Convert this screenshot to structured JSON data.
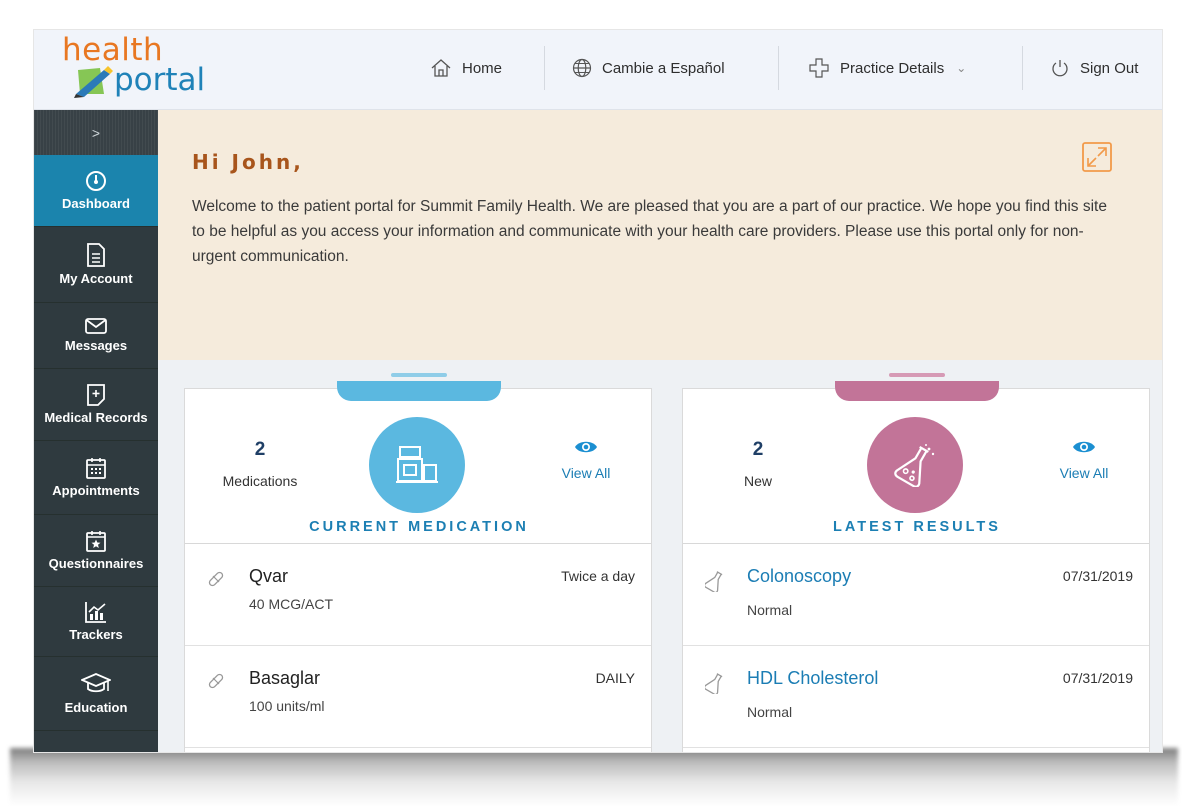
{
  "logo": {
    "line1": "health",
    "line2": "portal"
  },
  "nav": {
    "home": "Home",
    "language": "Cambie a Español",
    "practice": "Practice Details",
    "signout": "Sign Out"
  },
  "sidebar": {
    "toggle": ">",
    "items": [
      {
        "label": "Dashboard",
        "icon": "dashboard-gauge-icon",
        "active": true
      },
      {
        "label": "My Account",
        "icon": "document-icon"
      },
      {
        "label": "Messages",
        "icon": "envelope-icon"
      },
      {
        "label": "Medical Records",
        "icon": "medical-record-icon"
      },
      {
        "label": "Appointments",
        "icon": "calendar-icon"
      },
      {
        "label": "Questionnaires",
        "icon": "star-calendar-icon"
      },
      {
        "label": "Trackers",
        "icon": "chart-icon"
      },
      {
        "label": "Education",
        "icon": "graduation-cap-icon"
      }
    ]
  },
  "welcome": {
    "greeting": "Hi John,",
    "text": "Welcome to the patient portal for Summit Family Health. We are pleased that you are a part of our practice. We hope you find this site to be helpful as you access your information and communicate with your health care providers. Please use this portal only for non-urgent communication."
  },
  "medication": {
    "count": "2",
    "count_label": "Medications",
    "view_all": "View All",
    "title": "CURRENT MEDICATION",
    "accent": "#5bb8e0",
    "items": [
      {
        "name": "Qvar",
        "dose": "40 MCG/ACT",
        "frequency": "Twice a day"
      },
      {
        "name": "Basaglar",
        "dose": "100 units/ml",
        "frequency": "DAILY"
      }
    ]
  },
  "results": {
    "count": "2",
    "count_label": "New",
    "view_all": "View All",
    "title": "LATEST RESULTS",
    "accent": "#c27498",
    "items": [
      {
        "name": "Colonoscopy",
        "status": "Normal",
        "date": "07/31/2019"
      },
      {
        "name": "HDL Cholesterol",
        "status": "Normal",
        "date": "07/31/2019"
      }
    ]
  },
  "colors": {
    "header_bg": "#f1f4fa",
    "sidebar_bg": "#2f3a3f",
    "sidebar_active": "#1b84ad",
    "welcome_bg": "#f5ebdc",
    "greeting": "#a8551c",
    "link": "#1b7db4"
  }
}
